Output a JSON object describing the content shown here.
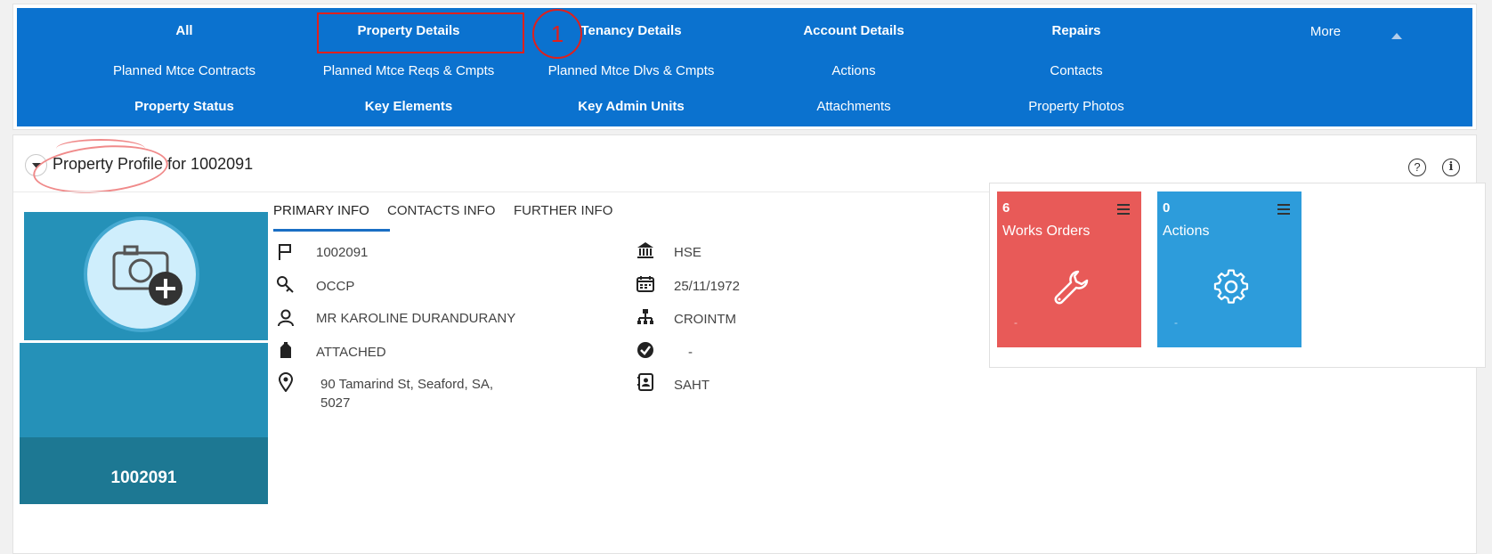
{
  "nav": {
    "row1": [
      "All",
      "Property Details",
      "Tenancy Details",
      "Account Details",
      "Repairs"
    ],
    "more_label": "More",
    "row2": [
      "Planned Mtce Contracts",
      "Planned Mtce Reqs & Cmpts",
      "Planned Mtce Dlvs & Cmpts",
      "Actions",
      "Contacts"
    ],
    "row3": [
      "Property Status",
      "Key Elements",
      "Key Admin Units",
      "Attachments",
      "Property Photos"
    ],
    "step_marker": "1"
  },
  "panel": {
    "title": "Property Profile for 1002091",
    "help_icon": "?",
    "info_icon": "i",
    "photo_label": "1002091"
  },
  "tabs": [
    "PRIMARY INFO",
    "CONTACTS INFO",
    "FURTHER INFO"
  ],
  "primary_info": {
    "left": [
      {
        "icon": "flag-icon",
        "value": "1002091"
      },
      {
        "icon": "key-icon",
        "value": "OCCP"
      },
      {
        "icon": "person-icon",
        "value": "MR KAROLINE DURANDURANY"
      },
      {
        "icon": "building-icon",
        "value": "ATTACHED"
      },
      {
        "icon": "location-pin-icon",
        "value": "90 Tamarind St, Seaford, SA,",
        "value2": "5027"
      }
    ],
    "right": [
      {
        "icon": "bank-icon",
        "value": "HSE"
      },
      {
        "icon": "calendar-icon",
        "value": "25/11/1972"
      },
      {
        "icon": "hierarchy-icon",
        "value": "CROINTM"
      },
      {
        "icon": "check-circle-icon",
        "value": "-"
      },
      {
        "icon": "contact-card-icon",
        "value": "SAHT"
      }
    ]
  },
  "tiles": [
    {
      "count": "6",
      "label": "Works Orders",
      "sub": "-",
      "color": "#e85a58",
      "icon": "wrench-icon"
    },
    {
      "count": "0",
      "label": "Actions",
      "sub": "-",
      "color": "#2d9cdb",
      "icon": "gear-icon"
    }
  ],
  "colors": {
    "nav_bg": "#0b72cf",
    "annotation_red": "#e0201c",
    "photo_bg": "#2591b8"
  }
}
